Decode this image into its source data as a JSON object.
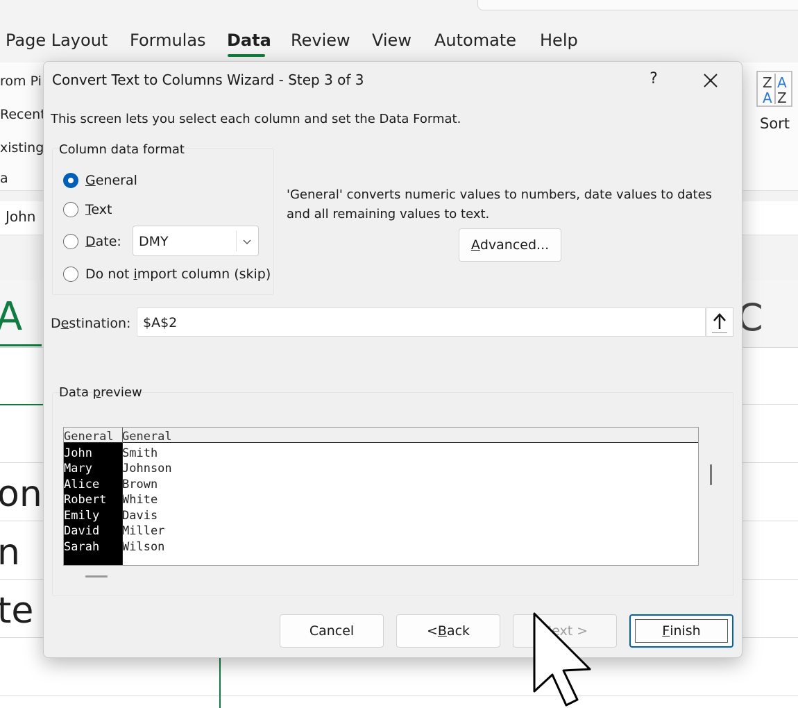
{
  "ribbon": {
    "tabs": [
      "Page Layout",
      "Formulas",
      "Data",
      "Review",
      "View",
      "Automate",
      "Help"
    ],
    "active_tab": "Data",
    "left_items": [
      "rom Pi",
      "Recent",
      "xisting",
      "a"
    ],
    "sort_label": "Sort"
  },
  "namebox": {
    "value": "John"
  },
  "sheet": {
    "col_a_header": "A",
    "col_c_header": "C",
    "cells": [
      "on",
      "n",
      "te"
    ]
  },
  "dialog": {
    "title": "Convert Text to Columns Wizard - Step 3 of 3",
    "help": "?",
    "intro": "This screen lets you select each column and set the Data Format.",
    "column_format": {
      "label": "Column data format",
      "options": [
        {
          "pre": "",
          "key": "G",
          "post": "eneral",
          "checked": true
        },
        {
          "pre": "",
          "key": "T",
          "post": "ext",
          "checked": false
        },
        {
          "pre": "",
          "key": "D",
          "post": "ate:",
          "checked": false
        },
        {
          "pre": "Do not ",
          "key": "i",
          "post": "mport column (skip)",
          "checked": false
        }
      ],
      "date_value": "DMY"
    },
    "description": "'General' converts numeric values to numbers, date values to dates and all remaining values to text.",
    "advanced": {
      "key": "A",
      "rest": "dvanced..."
    },
    "destination": {
      "pre": "D",
      "key": "e",
      "post": "stination:",
      "value": "$A$2"
    },
    "preview": {
      "label_pre": "Data ",
      "label_key": "p",
      "label_post": "review",
      "headers": [
        "General",
        "General"
      ],
      "rows": [
        [
          "John",
          "Smith"
        ],
        [
          "Mary",
          "Johnson"
        ],
        [
          "Alice",
          "Brown"
        ],
        [
          "Robert",
          "White"
        ],
        [
          "Emily",
          "Davis"
        ],
        [
          "David",
          "Miller"
        ],
        [
          "Sarah",
          "Wilson"
        ]
      ]
    },
    "buttons": {
      "cancel": "Cancel",
      "back_pre": "< ",
      "back_key": "B",
      "back_post": "ack",
      "next": "Next >",
      "finish_key": "F",
      "finish_post": "inish"
    }
  }
}
